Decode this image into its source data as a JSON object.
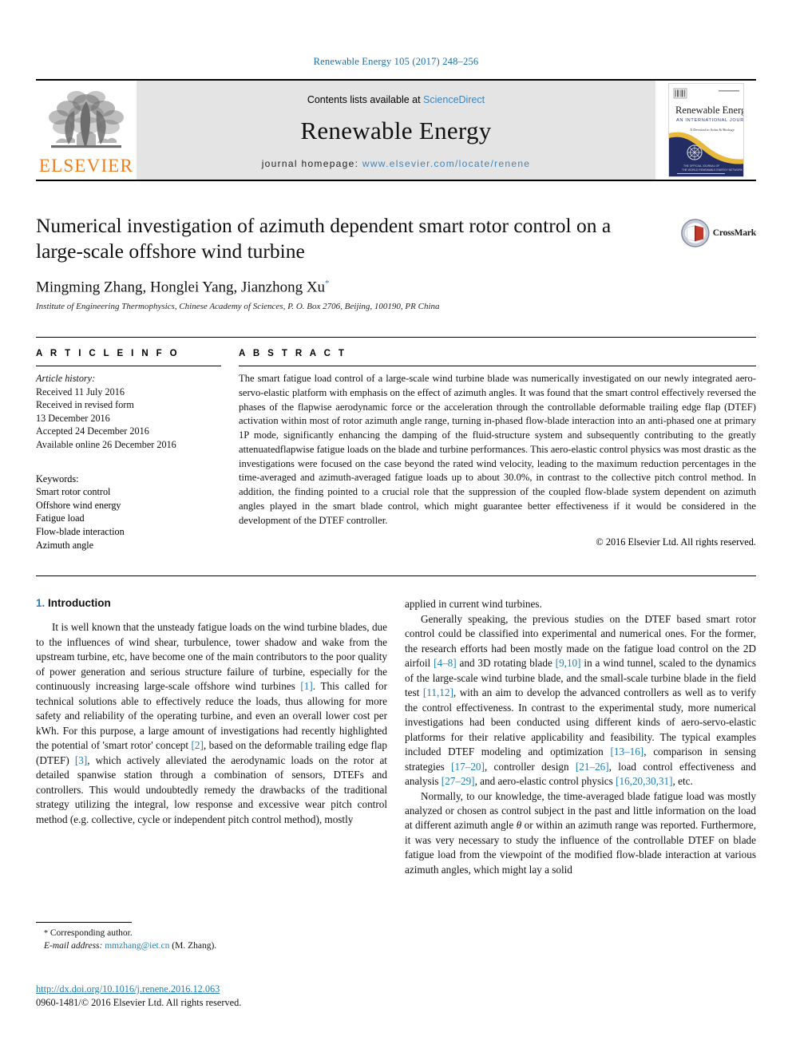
{
  "running_head": "Renewable Energy 105 (2017) 248–256",
  "masthead": {
    "publisher_logo_text": "ELSEVIER",
    "contents_prefix": "Contents lists available at ",
    "contents_link": "ScienceDirect",
    "journal_title": "Renewable Energy",
    "homepage_prefix": "journal homepage: ",
    "homepage_url": "www.elsevier.com/locate/renene",
    "cover": {
      "title": "Renewable Energy",
      "subtitle": "AN INTERNATIONAL JOURNAL",
      "tagline": "A Devoted to Fuel Solar & Biology et al."
    }
  },
  "article": {
    "title": "Numerical investigation of azimuth dependent smart rotor control on a large-scale offshore wind turbine",
    "authors": "Mingming Zhang, Honglei Yang, Jianzhong Xu",
    "author_marker": "*",
    "affiliation": "Institute of Engineering Thermophysics, Chinese Academy of Sciences, P. O. Box 2706, Beijing, 100190, PR China",
    "crossmark_label": "CrossMark"
  },
  "article_info": {
    "heading": "A R T I C L E   I N F O",
    "history_label": "Article history:",
    "history": [
      "Received 11 July 2016",
      "Received in revised form",
      "13 December 2016",
      "Accepted 24 December 2016",
      "Available online 26 December 2016"
    ],
    "keywords_label": "Keywords:",
    "keywords": [
      "Smart rotor control",
      "Offshore wind energy",
      "Fatigue load",
      "Flow-blade interaction",
      "Azimuth angle"
    ]
  },
  "abstract": {
    "heading": "A B S T R A C T",
    "text": "The smart fatigue load control of a large-scale wind turbine blade was numerically investigated on our newly integrated aero-servo-elastic platform with emphasis on the effect of azimuth angles. It was found that the smart control effectively reversed the phases of the flapwise aerodynamic force or the acceleration through the controllable deformable trailing edge flap (DTEF) activation within most of rotor azimuth angle range, turning in-phased flow-blade interaction into an anti-phased one at primary 1P mode, significantly enhancing the damping of the fluid-structure system and subsequently contributing to the greatly attenuatedflapwise fatigue loads on the blade and turbine performances. This aero-elastic control physics was most drastic as the investigations were focused on the case beyond the rated wind velocity, leading to the maximum reduction percentages in the time-averaged and azimuth-averaged fatigue loads up to about 30.0%, in contrast to the collective pitch control method. In addition, the finding pointed to a crucial role that the suppression of the coupled flow-blade system dependent on azimuth angles played in the smart blade control, which might guarantee better effectiveness if it would be considered in the development of the DTEF controller.",
    "copyright": "© 2016 Elsevier Ltd. All rights reserved."
  },
  "body": {
    "section_number": "1.",
    "section_title": "Introduction",
    "left_paragraphs": [
      {
        "segments": [
          {
            "t": "It is well known that the unsteady fatigue loads on the wind turbine blades, due to the influences of wind shear, turbulence, tower shadow and wake from the upstream turbine, etc, have become one of the main contributors to the poor quality of power generation and serious structure failure of turbine, especially for the continuously increasing large-scale offshore wind turbines "
          },
          {
            "t": "[1]",
            "ref": true
          },
          {
            "t": ". This called for technical solutions able to effectively reduce the loads, thus allowing for more safety and reliability of the operating turbine, and even an overall lower cost per kWh. For this purpose, a large amount of investigations had recently highlighted the potential of 'smart rotor' concept "
          },
          {
            "t": "[2]",
            "ref": true
          },
          {
            "t": ", based on the deformable trailing edge flap (DTEF) "
          },
          {
            "t": "[3]",
            "ref": true
          },
          {
            "t": ", which actively alleviated the aerodynamic loads on the rotor at detailed spanwise station through a combination of sensors, DTEFs and controllers. This would undoubtedly remedy the drawbacks of the traditional strategy utilizing the integral, low response and excessive wear pitch control method (e.g. collective, cycle or independent pitch control method), mostly"
          }
        ]
      }
    ],
    "right_paragraphs": [
      {
        "indent": false,
        "segments": [
          {
            "t": "applied in current wind turbines."
          }
        ]
      },
      {
        "indent": true,
        "segments": [
          {
            "t": "Generally speaking, the previous studies on the DTEF based smart rotor control could be classified into experimental and numerical ones. For the former, the research efforts had been mostly made on the fatigue load control on the 2D airfoil "
          },
          {
            "t": "[4–8]",
            "ref": true
          },
          {
            "t": " and 3D rotating blade "
          },
          {
            "t": "[9,10]",
            "ref": true
          },
          {
            "t": " in a wind tunnel, scaled to the dynamics of the large-scale wind turbine blade, and the small-scale turbine blade in the field test "
          },
          {
            "t": "[11,12]",
            "ref": true
          },
          {
            "t": ", with an aim to develop the advanced controllers as well as to verify the control effectiveness. In contrast to the experimental study, more numerical investigations had been conducted using different kinds of aero-servo-elastic platforms for their relative applicability and feasibility. The typical examples included DTEF modeling and optimization "
          },
          {
            "t": "[13–16]",
            "ref": true
          },
          {
            "t": ", comparison in sensing strategies "
          },
          {
            "t": "[17–20]",
            "ref": true
          },
          {
            "t": ", controller design "
          },
          {
            "t": "[21–26]",
            "ref": true
          },
          {
            "t": ", load control effectiveness and analysis "
          },
          {
            "t": "[27–29]",
            "ref": true
          },
          {
            "t": ", and aero-elastic control physics "
          },
          {
            "t": "[16,20,30,31]",
            "ref": true
          },
          {
            "t": ", etc."
          }
        ]
      },
      {
        "indent": true,
        "segments": [
          {
            "t": "Normally, to our knowledge, the time-averaged blade fatigue load was mostly analyzed or chosen as control subject in the past and little information on the load at different azimuth angle "
          },
          {
            "t": "θ",
            "italic": true
          },
          {
            "t": " or within an azimuth range was reported. Furthermore, it was very necessary to study the influence of the controllable DTEF on blade fatigue load from the viewpoint of the modified flow-blade interaction at various azimuth angles, which might lay a solid"
          }
        ]
      }
    ]
  },
  "footnotes": {
    "corresponding_marker": "*",
    "corresponding_text": "Corresponding author.",
    "email_label": "E-mail address:",
    "email": "mmzhang@iet.cn",
    "email_owner": "(M. Zhang).",
    "doi": "http://dx.doi.org/10.1016/j.renene.2016.12.063",
    "issn": "0960-1481/© 2016 Elsevier Ltd. All rights reserved."
  },
  "colors": {
    "link": "#1f7fb3",
    "elsevier_orange": "#ef7d1a",
    "masthead_gray": "#e4e4e4",
    "cover_navy": "#232d63",
    "cover_gold": "#e8b93a"
  }
}
